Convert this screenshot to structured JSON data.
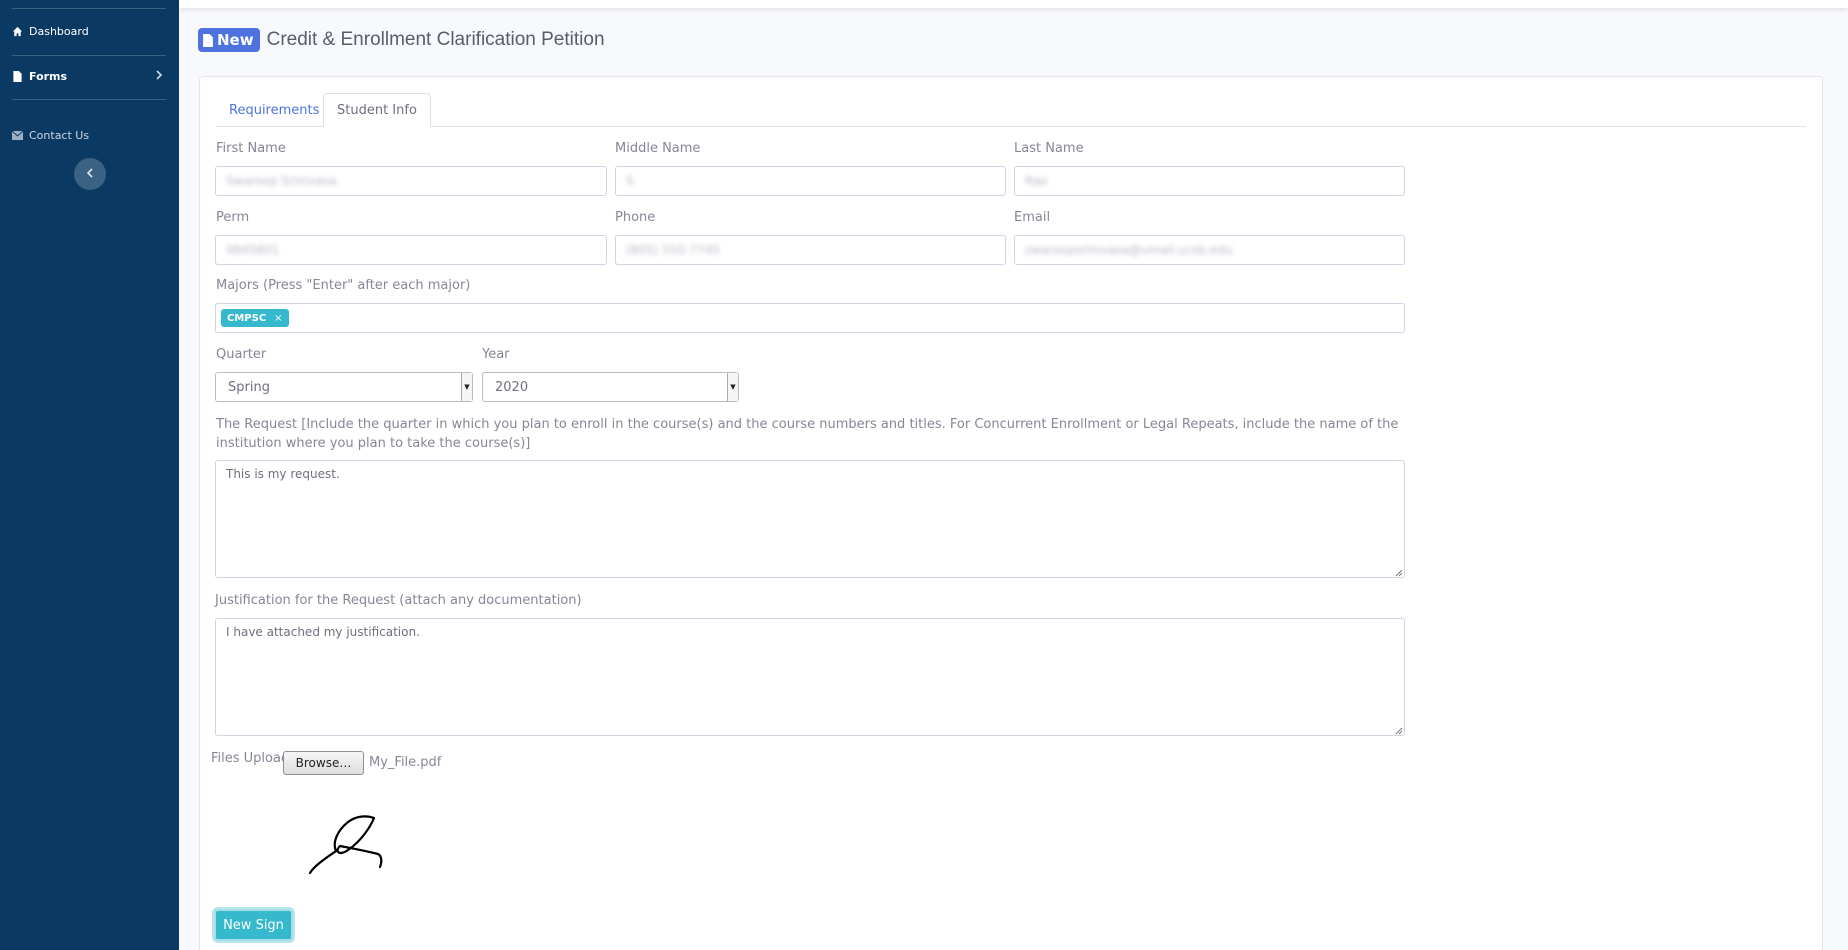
{
  "sidebar": {
    "items": [
      {
        "label": "Dashboard",
        "icon": "home-icon"
      },
      {
        "label": "Forms",
        "icon": "file-icon"
      },
      {
        "label": "Contact Us",
        "icon": "envelope-icon"
      }
    ]
  },
  "header": {
    "badge": "New",
    "title": "Credit & Enrollment Clarification Petition"
  },
  "tabs": [
    {
      "label": "Requirements",
      "active": false
    },
    {
      "label": "Student Info",
      "active": true
    }
  ],
  "form": {
    "first_name": {
      "label": "First Name",
      "value": "Swaroop Srinivasa"
    },
    "middle_name": {
      "label": "Middle Name",
      "value": "S"
    },
    "last_name": {
      "label": "Last Name",
      "value": "Rao"
    },
    "perm": {
      "label": "Perm",
      "value": "9845801"
    },
    "phone": {
      "label": "Phone",
      "value": "(805) 555-7745"
    },
    "email": {
      "label": "Email",
      "value": "swaroopsrinivasa@umail.ucsb.edu"
    },
    "majors": {
      "label": "Majors (Press \"Enter\" after each major)",
      "tags": [
        "CMPSC"
      ]
    },
    "quarter": {
      "label": "Quarter",
      "value": "Spring"
    },
    "year": {
      "label": "Year",
      "value": "2020"
    },
    "request": {
      "label": "The Request [Include the quarter in which you plan to enroll in the course(s) and the course numbers and titles. For Concurrent Enrollment or Legal Repeats, include the name of the institution where you plan to take the course(s)]",
      "value": "This is my request."
    },
    "justification": {
      "label": "Justification for the Request (attach any documentation)",
      "value": "I have attached my justification."
    },
    "files_upload": {
      "label": "Files Upload",
      "button": "Browse…",
      "filename": "My_File.pdf"
    },
    "new_sign_button": "New Sign"
  },
  "colors": {
    "sidebar": "#0a3a64",
    "primary": "#4e73df",
    "info": "#36b9cc"
  }
}
